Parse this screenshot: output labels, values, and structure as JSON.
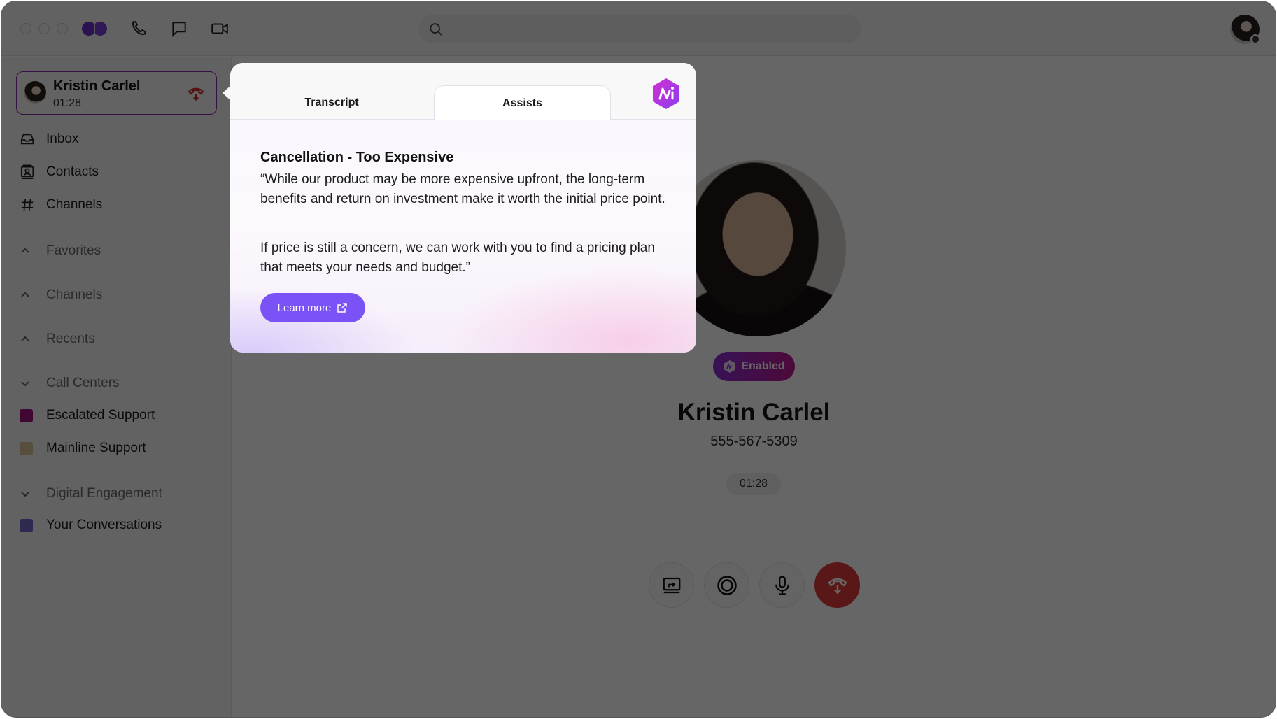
{
  "titlebar": {
    "window_controls": [
      "close",
      "minimize",
      "maximize"
    ],
    "nav_icons": [
      "phone-icon",
      "chat-icon",
      "video-icon"
    ],
    "search": {
      "placeholder": "",
      "value": ""
    },
    "user_status": "offline"
  },
  "sidebar": {
    "active_call": {
      "name": "Kristin Carlel",
      "duration": "01:28",
      "hangup_icon": "hangup-icon"
    },
    "nav": [
      {
        "label": "Inbox",
        "icon": "inbox-icon"
      },
      {
        "label": "Contacts",
        "icon": "contacts-icon"
      },
      {
        "label": "Channels",
        "icon": "hash-icon"
      }
    ],
    "sections": [
      {
        "label": "Favorites",
        "state": "collapsed"
      },
      {
        "label": "Channels",
        "state": "collapsed"
      },
      {
        "label": "Recents",
        "state": "collapsed"
      },
      {
        "label": "Call Centers",
        "state": "expanded",
        "items": [
          {
            "label": "Escalated Support",
            "color": "#a3137f"
          },
          {
            "label": "Mainline Support",
            "color": "#d9c39a"
          }
        ]
      },
      {
        "label": "Digital Engagement",
        "state": "expanded",
        "items": [
          {
            "label": "Your Conversations",
            "color": "#7366c9"
          }
        ]
      }
    ]
  },
  "popover": {
    "tabs": [
      {
        "label": "Transcript",
        "active": false
      },
      {
        "label": "Assists",
        "active": true
      }
    ],
    "assist": {
      "title": "Cancellation - Too Expensive",
      "paragraph_1": "“While our product may be more expensive upfront, the long-term benefits and return on investment make it worth the initial price point.",
      "paragraph_2": "If price is still a concern, we can work with you to find a pricing plan that meets your needs and budget.”",
      "button_label": "Learn more"
    }
  },
  "call": {
    "ai_badge": "Enabled",
    "caller_name": "Kristin Carlel",
    "caller_phone": "555-567-5309",
    "timer": "01:28",
    "controls": [
      "screen-share",
      "record",
      "mute",
      "hang-up"
    ]
  },
  "colors": {
    "brand_purple": "#6b2fc9",
    "accent_button": "#7b52f5",
    "hangup_red": "#e23a3a",
    "active_border": "#8a2aa8"
  }
}
